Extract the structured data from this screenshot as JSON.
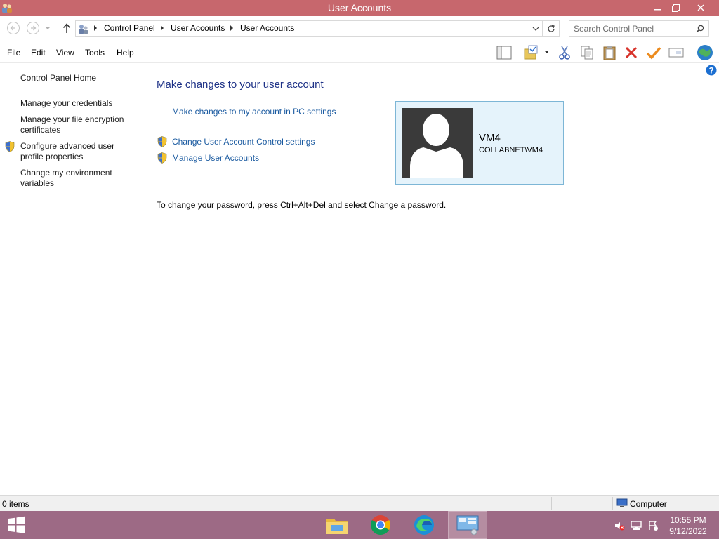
{
  "window": {
    "title": "User Accounts"
  },
  "address": {
    "crumbs": [
      "Control Panel",
      "User Accounts",
      "User Accounts"
    ]
  },
  "search": {
    "placeholder": "Search Control Panel"
  },
  "menu": {
    "file": "File",
    "edit": "Edit",
    "view": "View",
    "tools": "Tools",
    "help": "Help"
  },
  "leftnav": {
    "home": "Control Panel Home",
    "credentials": "Manage your credentials",
    "encryption": "Manage your file encryption certificates",
    "profile": "Configure advanced user profile properties",
    "environment": "Change my environment variables"
  },
  "main": {
    "heading": "Make changes to your user account",
    "pc_settings": "Make changes to my account in PC settings",
    "uac": "Change User Account Control settings",
    "manage": "Manage User Accounts",
    "password_note": "To change your password, press Ctrl+Alt+Del and select Change a password."
  },
  "user": {
    "name": "VM4",
    "domain": "COLLABNET\\VM4"
  },
  "status": {
    "items": "0 items",
    "location": "Computer"
  },
  "clock": {
    "time": "10:55 PM",
    "date": "9/12/2022"
  },
  "colors": {
    "titlebar": "#c7676d",
    "taskbar": "#9d6a85",
    "link": "#1a5aa0",
    "heading": "#1e3287",
    "card_bg": "#e5f3fb"
  },
  "icons": [
    "users-icon",
    "minimize-icon",
    "maximize-icon",
    "close-icon",
    "back-icon",
    "forward-icon",
    "up-icon",
    "refresh-icon",
    "search-icon",
    "shield-icon",
    "help-icon",
    "start-icon",
    "file-explorer-icon",
    "chrome-icon",
    "edge-icon",
    "control-panel-icon"
  ]
}
